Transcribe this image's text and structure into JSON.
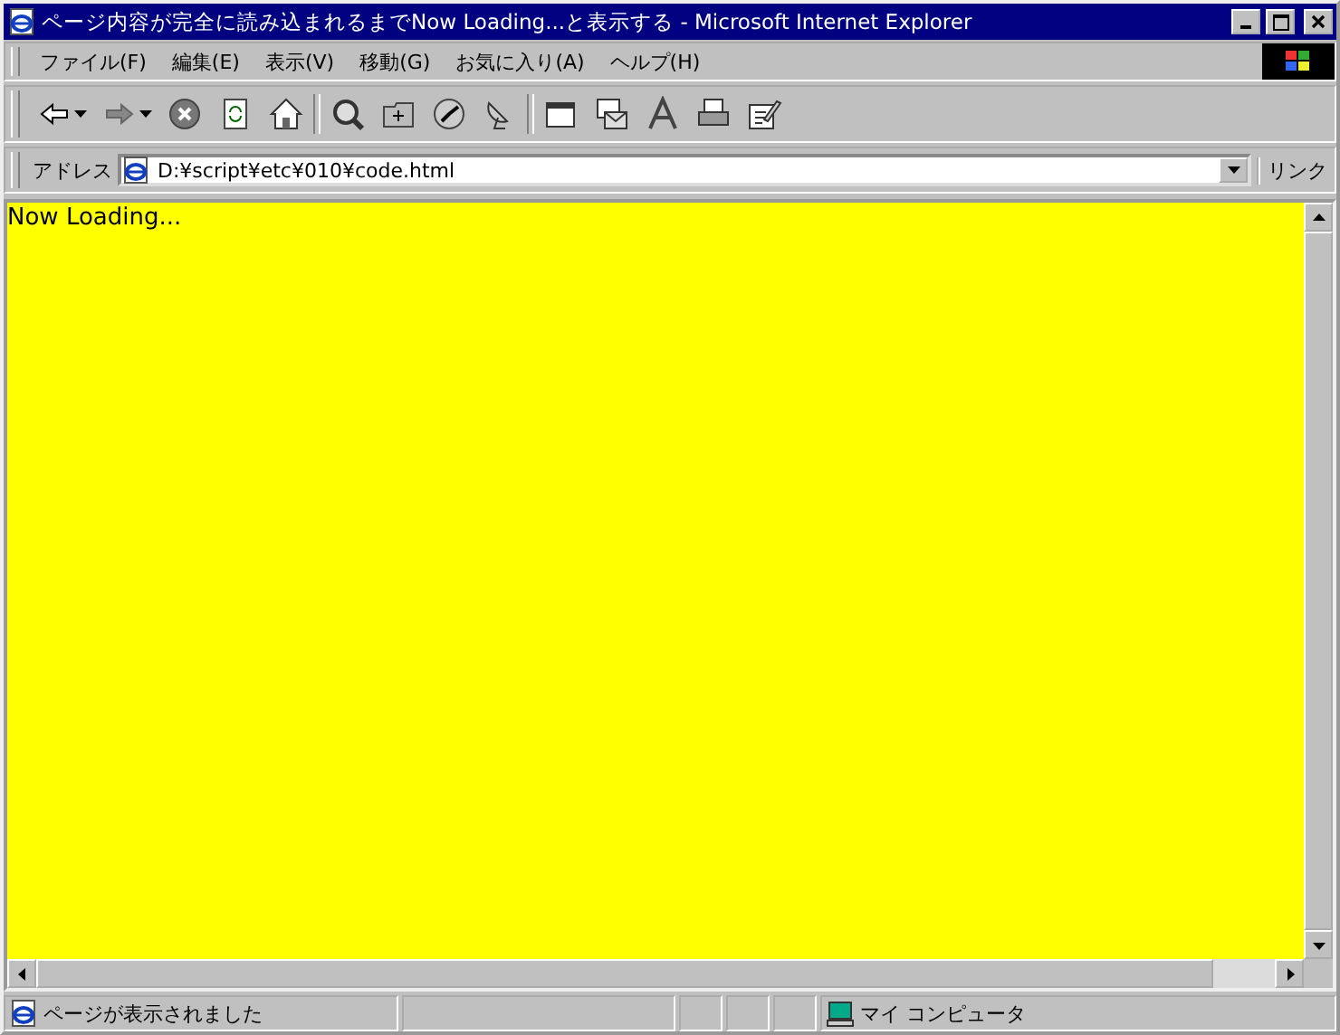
{
  "window": {
    "title": "ページ内容が完全に読み込まれるまでNow Loading...と表示する - Microsoft Internet Explorer"
  },
  "menu": [
    "ファイル(F)",
    "編集(E)",
    "表示(V)",
    "移動(G)",
    "お気に入り(A)",
    "ヘルプ(H)"
  ],
  "address_bar": {
    "label": "アドレス",
    "value": "D:¥script¥etc¥010¥code.html",
    "links": "リンク"
  },
  "page": {
    "text": "Now Loading..."
  },
  "status_bar": {
    "message": "ページが表示されました",
    "zone": "マイ コンピュータ"
  }
}
